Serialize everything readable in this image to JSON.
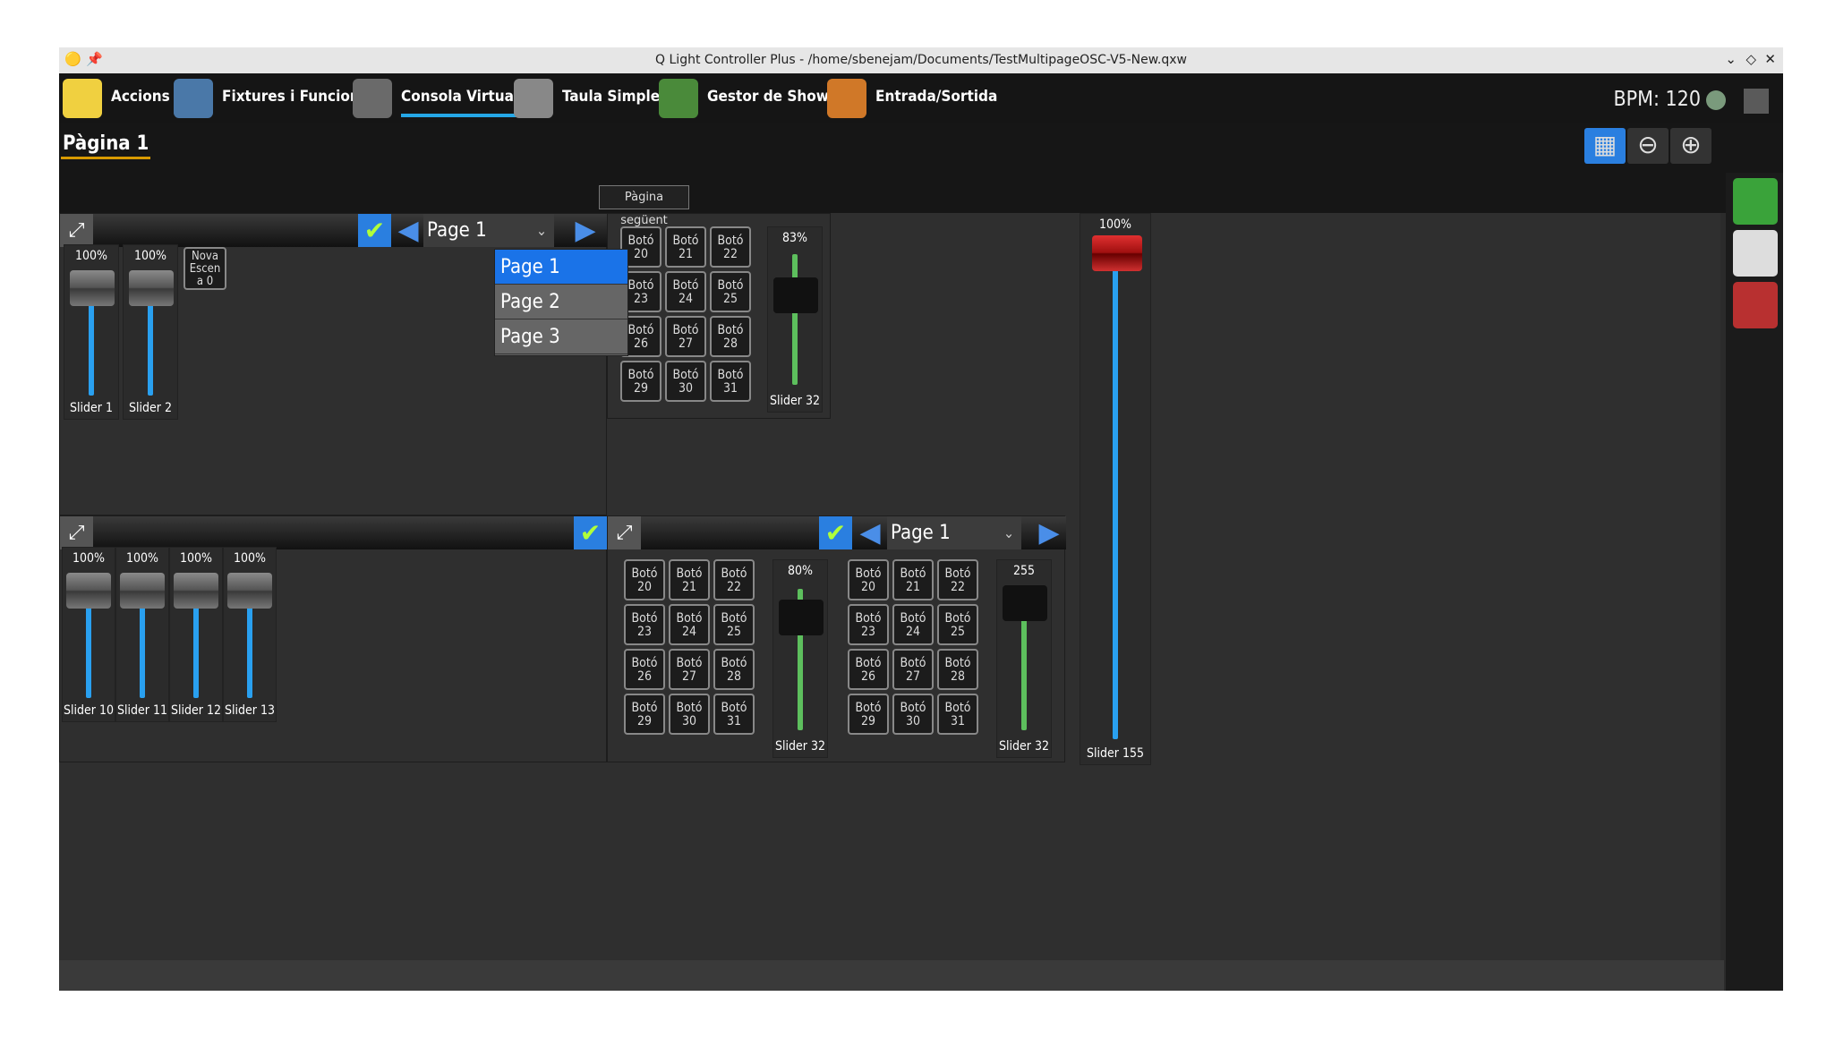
{
  "window": {
    "title": "Q Light Controller Plus - /home/sbenejam/Documents/TestMultipageOSC-V5-New.qxw",
    "controls": [
      "⌄",
      "◇",
      "✕"
    ]
  },
  "tabs": [
    {
      "label": "Accions"
    },
    {
      "label": "Fixtures i Funcions"
    },
    {
      "label": "Consola Virtual"
    },
    {
      "label": "Taula Simple"
    },
    {
      "label": "Gestor de Shows"
    },
    {
      "label": "Entrada/Sortida"
    }
  ],
  "bpm": {
    "label": "BPM: 120"
  },
  "page": {
    "label": "Pàgina 1"
  },
  "tooltip": "Pàgina següent",
  "dropdown": {
    "items": [
      "Page 1",
      "Page 2",
      "Page 3"
    ],
    "selected": "Page 1"
  },
  "frame1": {
    "page": "Page 1",
    "sliders": [
      {
        "pct": "100%",
        "name": "Slider 1"
      },
      {
        "pct": "100%",
        "name": "Slider 2"
      }
    ],
    "scene": "Nova Escen a 0"
  },
  "frame_grid1": {
    "buttons": [
      "Botó 20",
      "Botó 21",
      "Botó 22",
      "Botó 23",
      "Botó 24",
      "Botó 25",
      "Botó 26",
      "Botó 27",
      "Botó 28",
      "Botó 29",
      "Botó 30",
      "Botó 31"
    ],
    "slider": {
      "pct": "83%",
      "name": "Slider 32"
    }
  },
  "frame2": {
    "sliders": [
      {
        "pct": "100%",
        "name": "Slider 10"
      },
      {
        "pct": "100%",
        "name": "Slider 11"
      },
      {
        "pct": "100%",
        "name": "Slider 12"
      },
      {
        "pct": "100%",
        "name": "Slider 13"
      }
    ]
  },
  "frame3": {
    "page": "Page 1",
    "gridA": {
      "slider": {
        "pct": "80%",
        "name": "Slider 32"
      }
    },
    "gridB": {
      "slider": {
        "pct": "255",
        "name": "Slider 32"
      }
    }
  },
  "slider155": {
    "pct": "100%",
    "name": "Slider 155"
  }
}
